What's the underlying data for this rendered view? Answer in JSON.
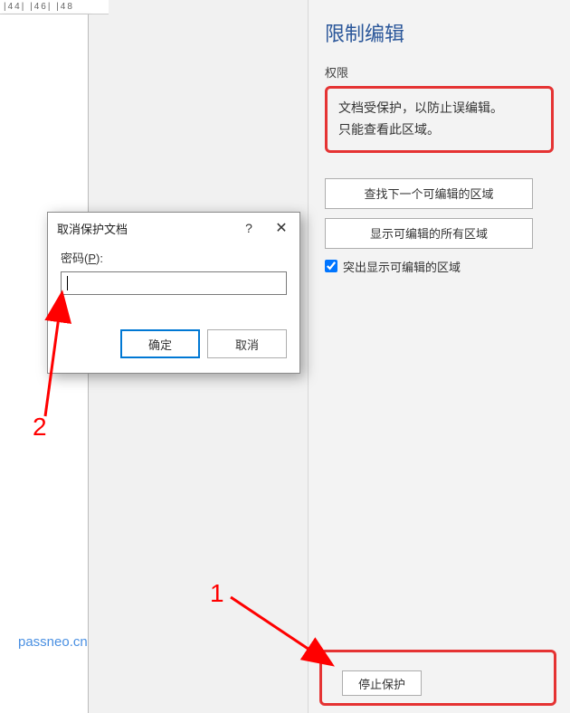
{
  "ruler": "|44|  |46|  |48",
  "sidebar": {
    "title": "限制编辑",
    "perm_label": "权限",
    "perm_line1": "文档受保护，以防止误编辑。",
    "perm_line2": "只能查看此区域。",
    "find_next": "查找下一个可编辑的区域",
    "show_all": "显示可编辑的所有区域",
    "highlight_checked": true,
    "highlight_label": "突出显示可编辑的区域",
    "stop_protect": "停止保护"
  },
  "dialog": {
    "title": "取消保护文档",
    "help": "?",
    "close": "✕",
    "password_label_pre": "密码(",
    "password_label_key": "P",
    "password_label_post": "):",
    "password_value": "",
    "ok": "确定",
    "cancel": "取消"
  },
  "annotations": {
    "num1": "1",
    "num2": "2",
    "watermark": "passneo.cn"
  }
}
